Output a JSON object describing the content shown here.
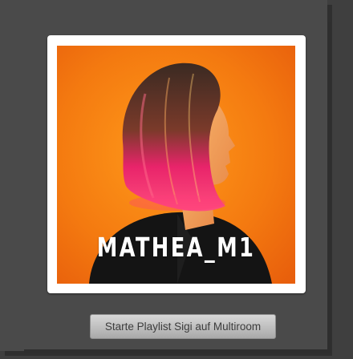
{
  "album": {
    "title": "MATHEA_M1",
    "cover_icon": "album-cover-image",
    "colors": {
      "background": "#f07a0e",
      "hair_top": "#3b2b22",
      "hair_tips": "#e8246a",
      "jacket": "#141414"
    }
  },
  "actions": {
    "play_button_label": "Starte Playlist Sigi auf Multiroom"
  }
}
